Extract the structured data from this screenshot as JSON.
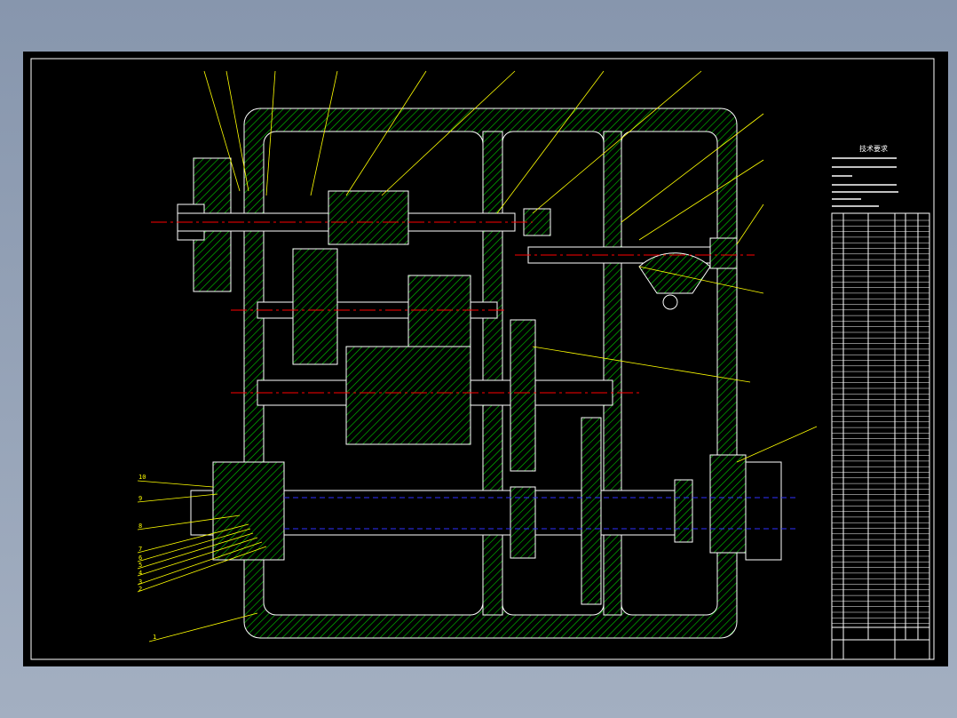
{
  "drawing": {
    "notes_title": "技术要求",
    "balloons_left": [
      "10",
      "9",
      "8",
      "7",
      "6",
      "5",
      "4",
      "3",
      "2",
      "1"
    ],
    "colors": {
      "background": "#000000",
      "frame": "#ffffff",
      "hatch": "#00c000",
      "leader": "#ffff00",
      "centerline": "#ff0000",
      "hidden": "#0000ff"
    }
  }
}
